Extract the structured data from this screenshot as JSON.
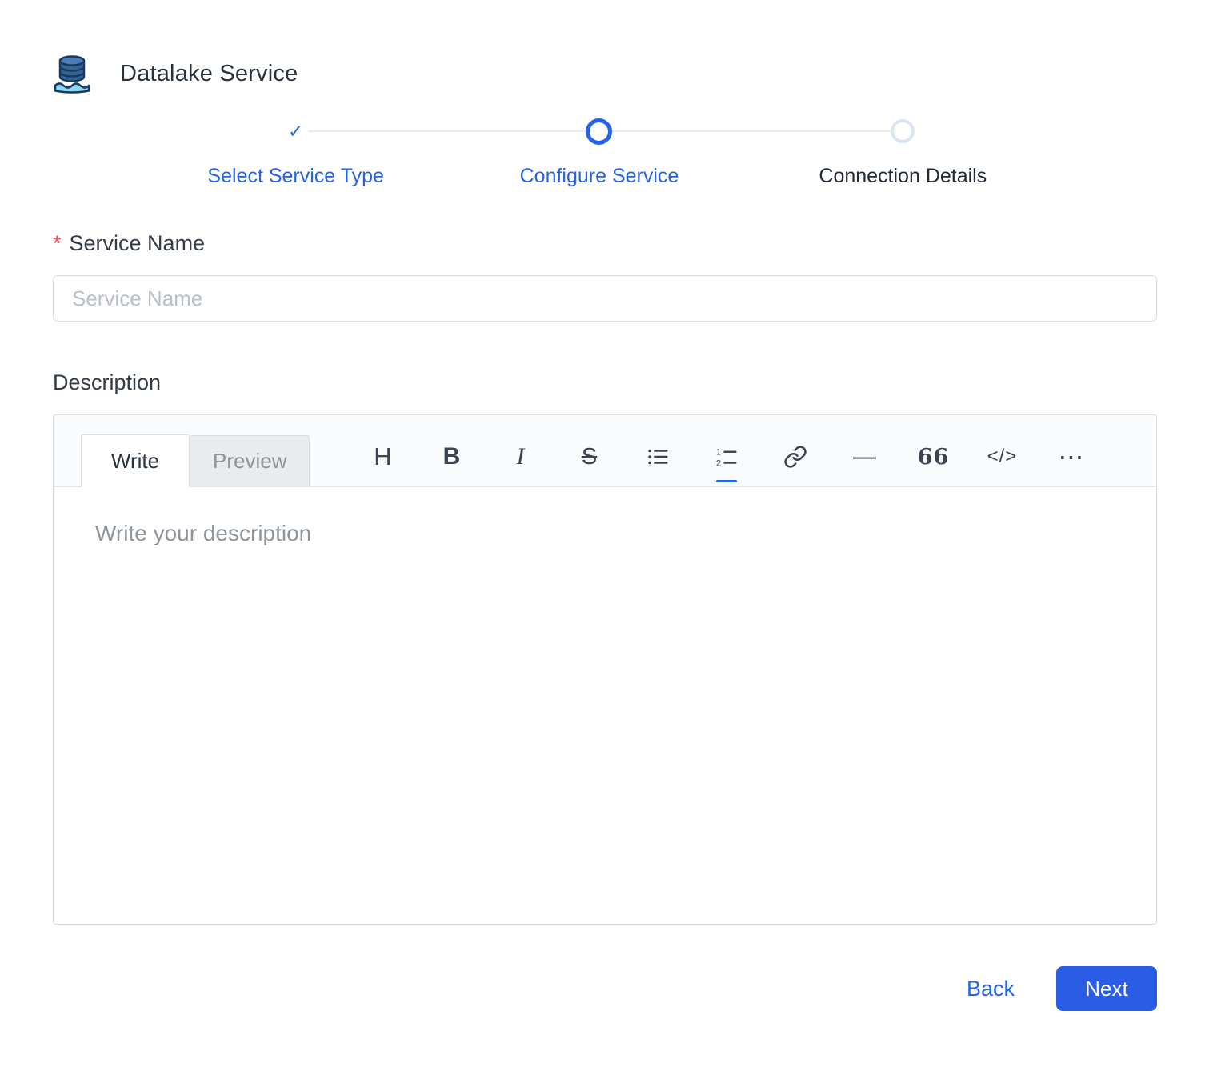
{
  "header": {
    "title": "Datalake Service"
  },
  "icons": {
    "check": "✓"
  },
  "stepper": {
    "steps": [
      {
        "label": "Select Service Type",
        "state": "completed"
      },
      {
        "label": "Configure Service",
        "state": "active"
      },
      {
        "label": "Connection Details",
        "state": "pending"
      }
    ]
  },
  "form": {
    "service_name": {
      "label": "Service Name",
      "required_marker": "*",
      "placeholder": "Service Name",
      "value": ""
    },
    "description": {
      "label": "Description",
      "placeholder": "Write your description",
      "value": "",
      "tabs": [
        {
          "label": "Write",
          "active": true
        },
        {
          "label": "Preview",
          "active": false
        }
      ],
      "toolbar": [
        {
          "name": "heading",
          "glyph": "H"
        },
        {
          "name": "bold",
          "glyph": "B"
        },
        {
          "name": "italic",
          "glyph": "I"
        },
        {
          "name": "strikethrough",
          "glyph": "S"
        },
        {
          "name": "bulleted-list"
        },
        {
          "name": "numbered-list"
        },
        {
          "name": "link"
        },
        {
          "name": "horizontal-rule",
          "glyph": "—"
        },
        {
          "name": "quote",
          "glyph": "66"
        },
        {
          "name": "code",
          "glyph": "</>"
        },
        {
          "name": "more",
          "glyph": "⋯"
        }
      ]
    }
  },
  "footer": {
    "back_label": "Back",
    "next_label": "Next"
  },
  "colors": {
    "primary": "#2563eb",
    "next_button": "#2a5ce6",
    "required": "#ff4d4f",
    "connector": "#e6ecf5"
  }
}
